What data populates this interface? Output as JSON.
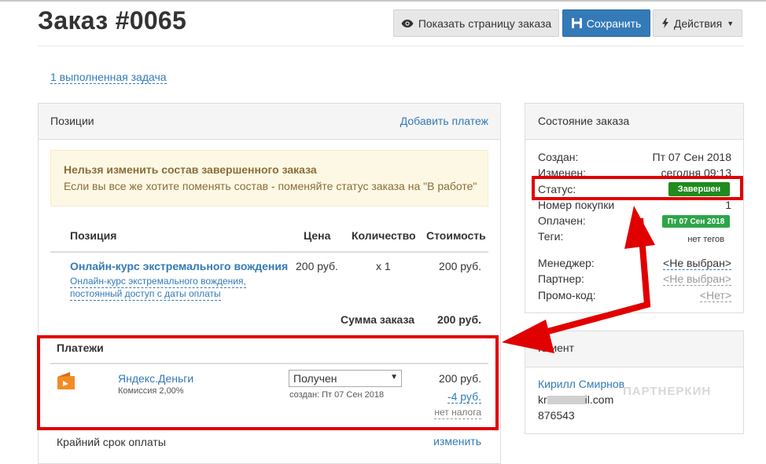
{
  "page": {
    "title": "Заказ #0065"
  },
  "toolbar": {
    "view_page_label": "Показать страницу заказа",
    "save_label": "Сохранить",
    "actions_label": "Действия"
  },
  "tasks_link": "1 выполненная задача",
  "positions_panel": {
    "title": "Позиции",
    "add_payment": "Добавить платеж",
    "warning_title": "Нельзя изменить состав завершенного заказа",
    "warning_text": "Если вы все же хотите поменять состав - поменяйте статус заказа на \"В работе\"",
    "columns": {
      "position": "Позиция",
      "price": "Цена",
      "quantity": "Количество",
      "cost": "Стоимость"
    },
    "item": {
      "name": "Онлайн-курс экстремального вождения",
      "desc_line1": "Онлайн-курс экстремального вождения,",
      "desc_line2": "постоянный доступ с даты оплаты",
      "price": "200 руб.",
      "quantity": "x 1",
      "cost": "200 руб."
    },
    "total_label": "Сумма заказа",
    "total_value": "200 руб."
  },
  "payments": {
    "title": "Платежи",
    "method": "Яндекс.Деньги",
    "commission": "Комиссия 2,00%",
    "status_selected": "Получен",
    "created": "создан: Пт 07 Сен 2018",
    "amount": "200 руб.",
    "fee": "-4 руб.",
    "tax": "нет налога"
  },
  "deadline": {
    "label": "Крайний срок оплаты",
    "change": "изменить"
  },
  "order_state": {
    "title": "Состояние заказа",
    "created_label": "Создан:",
    "created_value": "Пт 07 Сен 2018",
    "changed_label": "Изменен:",
    "changed_value": "сегодня 09:13",
    "status_label": "Статус:",
    "status_value": "Завершен",
    "purchase_label": "Номер покупки",
    "purchase_value": "1",
    "paid_label": "Оплачен:",
    "paid_value": "Пт 07 Сен 2018",
    "tags_label": "Теги:",
    "tags_value": "нет тегов",
    "manager_label": "Менеджер:",
    "manager_value": "<Не выбран>",
    "partner_label": "Партнер:",
    "partner_value": "<Не выбран>",
    "promo_label": "Промо-код:",
    "promo_value": "<Нет>"
  },
  "client": {
    "title": "Клиент",
    "name": "Кирилл Смирнов",
    "email_prefix": "kr",
    "email_suffix": "il.com",
    "phone": "876543"
  },
  "watermark": "ПАРТНЕРКИН",
  "colors": {
    "accent": "#337ab7",
    "success": "#1e8c1e",
    "annotation": "#e10000"
  }
}
